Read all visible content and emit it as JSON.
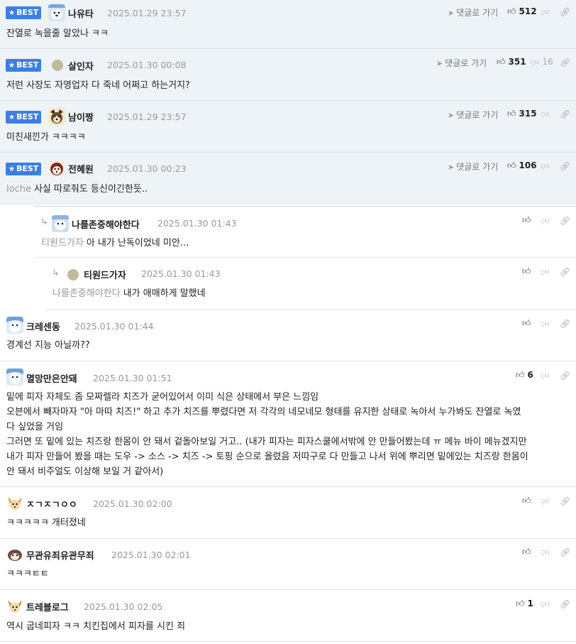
{
  "comments": [
    {
      "nick": "나유타",
      "date": "2025.01.29 23:57",
      "text": "잔열로 녹을줄 알았나 ㅋㅋ",
      "goto": "댓글로 가기",
      "up": "512",
      "down": "",
      "badge": "BEST"
    },
    {
      "nick": "살인자",
      "date": "2025.01.30 00:08",
      "text": "저런 사장도 자영업자 다 죽네 어쩌고 하는거지?",
      "goto": "댓글로 가기",
      "up": "351",
      "down": "16",
      "badge": "BEST"
    },
    {
      "nick": "남이짱",
      "date": "2025.01.29 23:57",
      "text": "미친새낀가 ㅋㅋㅋㅋ",
      "goto": "댓글로 가기",
      "up": "315",
      "down": "",
      "badge": "BEST"
    },
    {
      "nick": "전혜원",
      "date": "2025.01.30 00:23",
      "mention": "loche",
      "text": "사실 따로줘도 등신이긴한듯..",
      "goto": "댓글로 가기",
      "up": "106",
      "down": "",
      "badge": "BEST"
    },
    {
      "nick": "나를존중해야한다",
      "date": "2025.01.30 01:43",
      "mention": "티원드가자",
      "text": "아 내가 난독이었네 미안...",
      "up": "",
      "down": ""
    },
    {
      "nick": "티원드가자",
      "date": "2025.01.30 01:43",
      "mention": "나를존중해야한다",
      "text": "내가 애매하게 말했네",
      "up": "",
      "down": ""
    },
    {
      "nick": "크레센동",
      "date": "2025.01.30 01:44",
      "text": "경계선 지능 아닐까??",
      "up": "",
      "down": ""
    },
    {
      "nick": "멸망만은안돼",
      "date": "2025.01.30 01:51",
      "lines": [
        "밑에 피자 자체도 좀 모짜렐라 치즈가 굳어있어서 이미 식은 상태에서 부은 느낌임",
        "오븐에서 빼자마자 \"아 마따 치즈!\" 하고 추가 치즈를 뿌렸다면 저 각각의 네모네모 형태를 유지한 상태로 녹아서 누가봐도 잔열로 녹였",
        "다 싶었을 거임",
        "그러면 또 밑에 있는 치즈랑 한몸이 안 돼서 겉돌아보일 거고.. (내가 피자는 피자스쿨에서밖에 안 만들어봤는데 ㅠ 메뉴 바이 메뉴겠지만",
        "내가 피자 만들어 봤을 때는 도우 -> 소스 -> 치즈 -> 토핑 순으로 올렸음 저따구로 다 만들고 나서 위에 뿌리면 밑에있는 치즈랑 한몸이",
        "안 돼서 비주얼도 이상해 보일 거 같아서)"
      ],
      "up": "6",
      "down": ""
    },
    {
      "nick": "ㅈㄱㅈㄱㅇㅇ",
      "date": "2025.01.30 02:00",
      "text": "ㅋㅋㅋㅋㅋ 개터졌네",
      "up": "",
      "down": ""
    },
    {
      "nick": "무관유죄유관무죄",
      "date": "2025.01.30 02:01",
      "text": "ㅋㅋㅋㅌㅌ",
      "up": "",
      "down": ""
    },
    {
      "nick": "트레블로그",
      "date": "2025.01.30 02:05",
      "text": "역시 굽네피자 ㅋㅋ 치킨집에서 피자를 시킨 죄",
      "up": "1",
      "down": ""
    }
  ],
  "icons": {
    "thumb": "thumbs-up-icon",
    "link": "link-icon",
    "goto": "send-arrow-icon",
    "star": "star-icon",
    "reply": "reply-arrow-icon"
  },
  "colors": {
    "best_bg": "#eef3f8",
    "badge": "#3c7fe0"
  }
}
